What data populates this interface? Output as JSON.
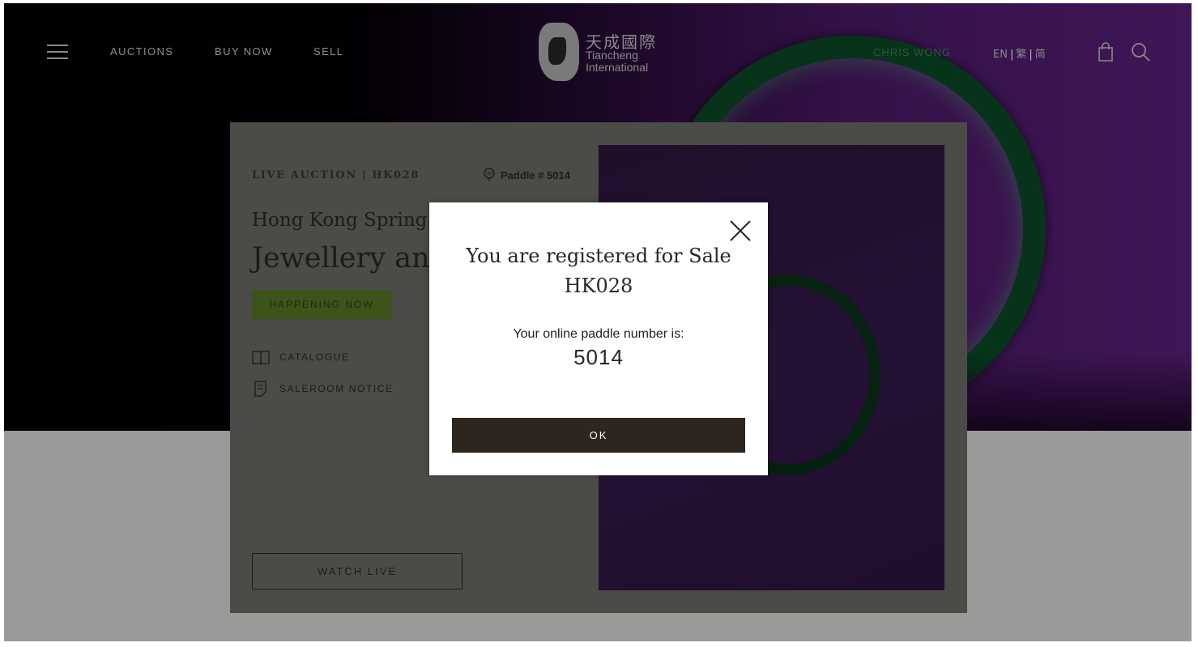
{
  "nav": {
    "links": [
      "AUCTIONS",
      "BUY NOW",
      "SELL"
    ],
    "logo_cn": "天成國際",
    "logo_en_line1": "Tiancheng",
    "logo_en_line2": "International",
    "user_name": "CHRIS WONG",
    "languages": [
      "EN",
      "繁",
      "简"
    ]
  },
  "card": {
    "eyebrow": "LIVE AUCTION | HK028",
    "paddle_label": "Paddle # 5014",
    "subtitle": "Hong Kong Spring Au",
    "title": "Jewellery and J",
    "status_badge": "HAPPENING NOW",
    "links": [
      "CATALOGUE",
      "SALEROOM NOTICE"
    ],
    "watch_live": "WATCH LIVE"
  },
  "modal": {
    "title": "You are registered for Sale HK028",
    "paddle_text": "Your online paddle number is:",
    "paddle_number": "5014",
    "ok_label": "OK"
  },
  "colors": {
    "hero_purple": "#3f1656",
    "status_green": "#3c5319",
    "ok_button": "#2d261f",
    "overlay_card": "#4b4b47"
  }
}
